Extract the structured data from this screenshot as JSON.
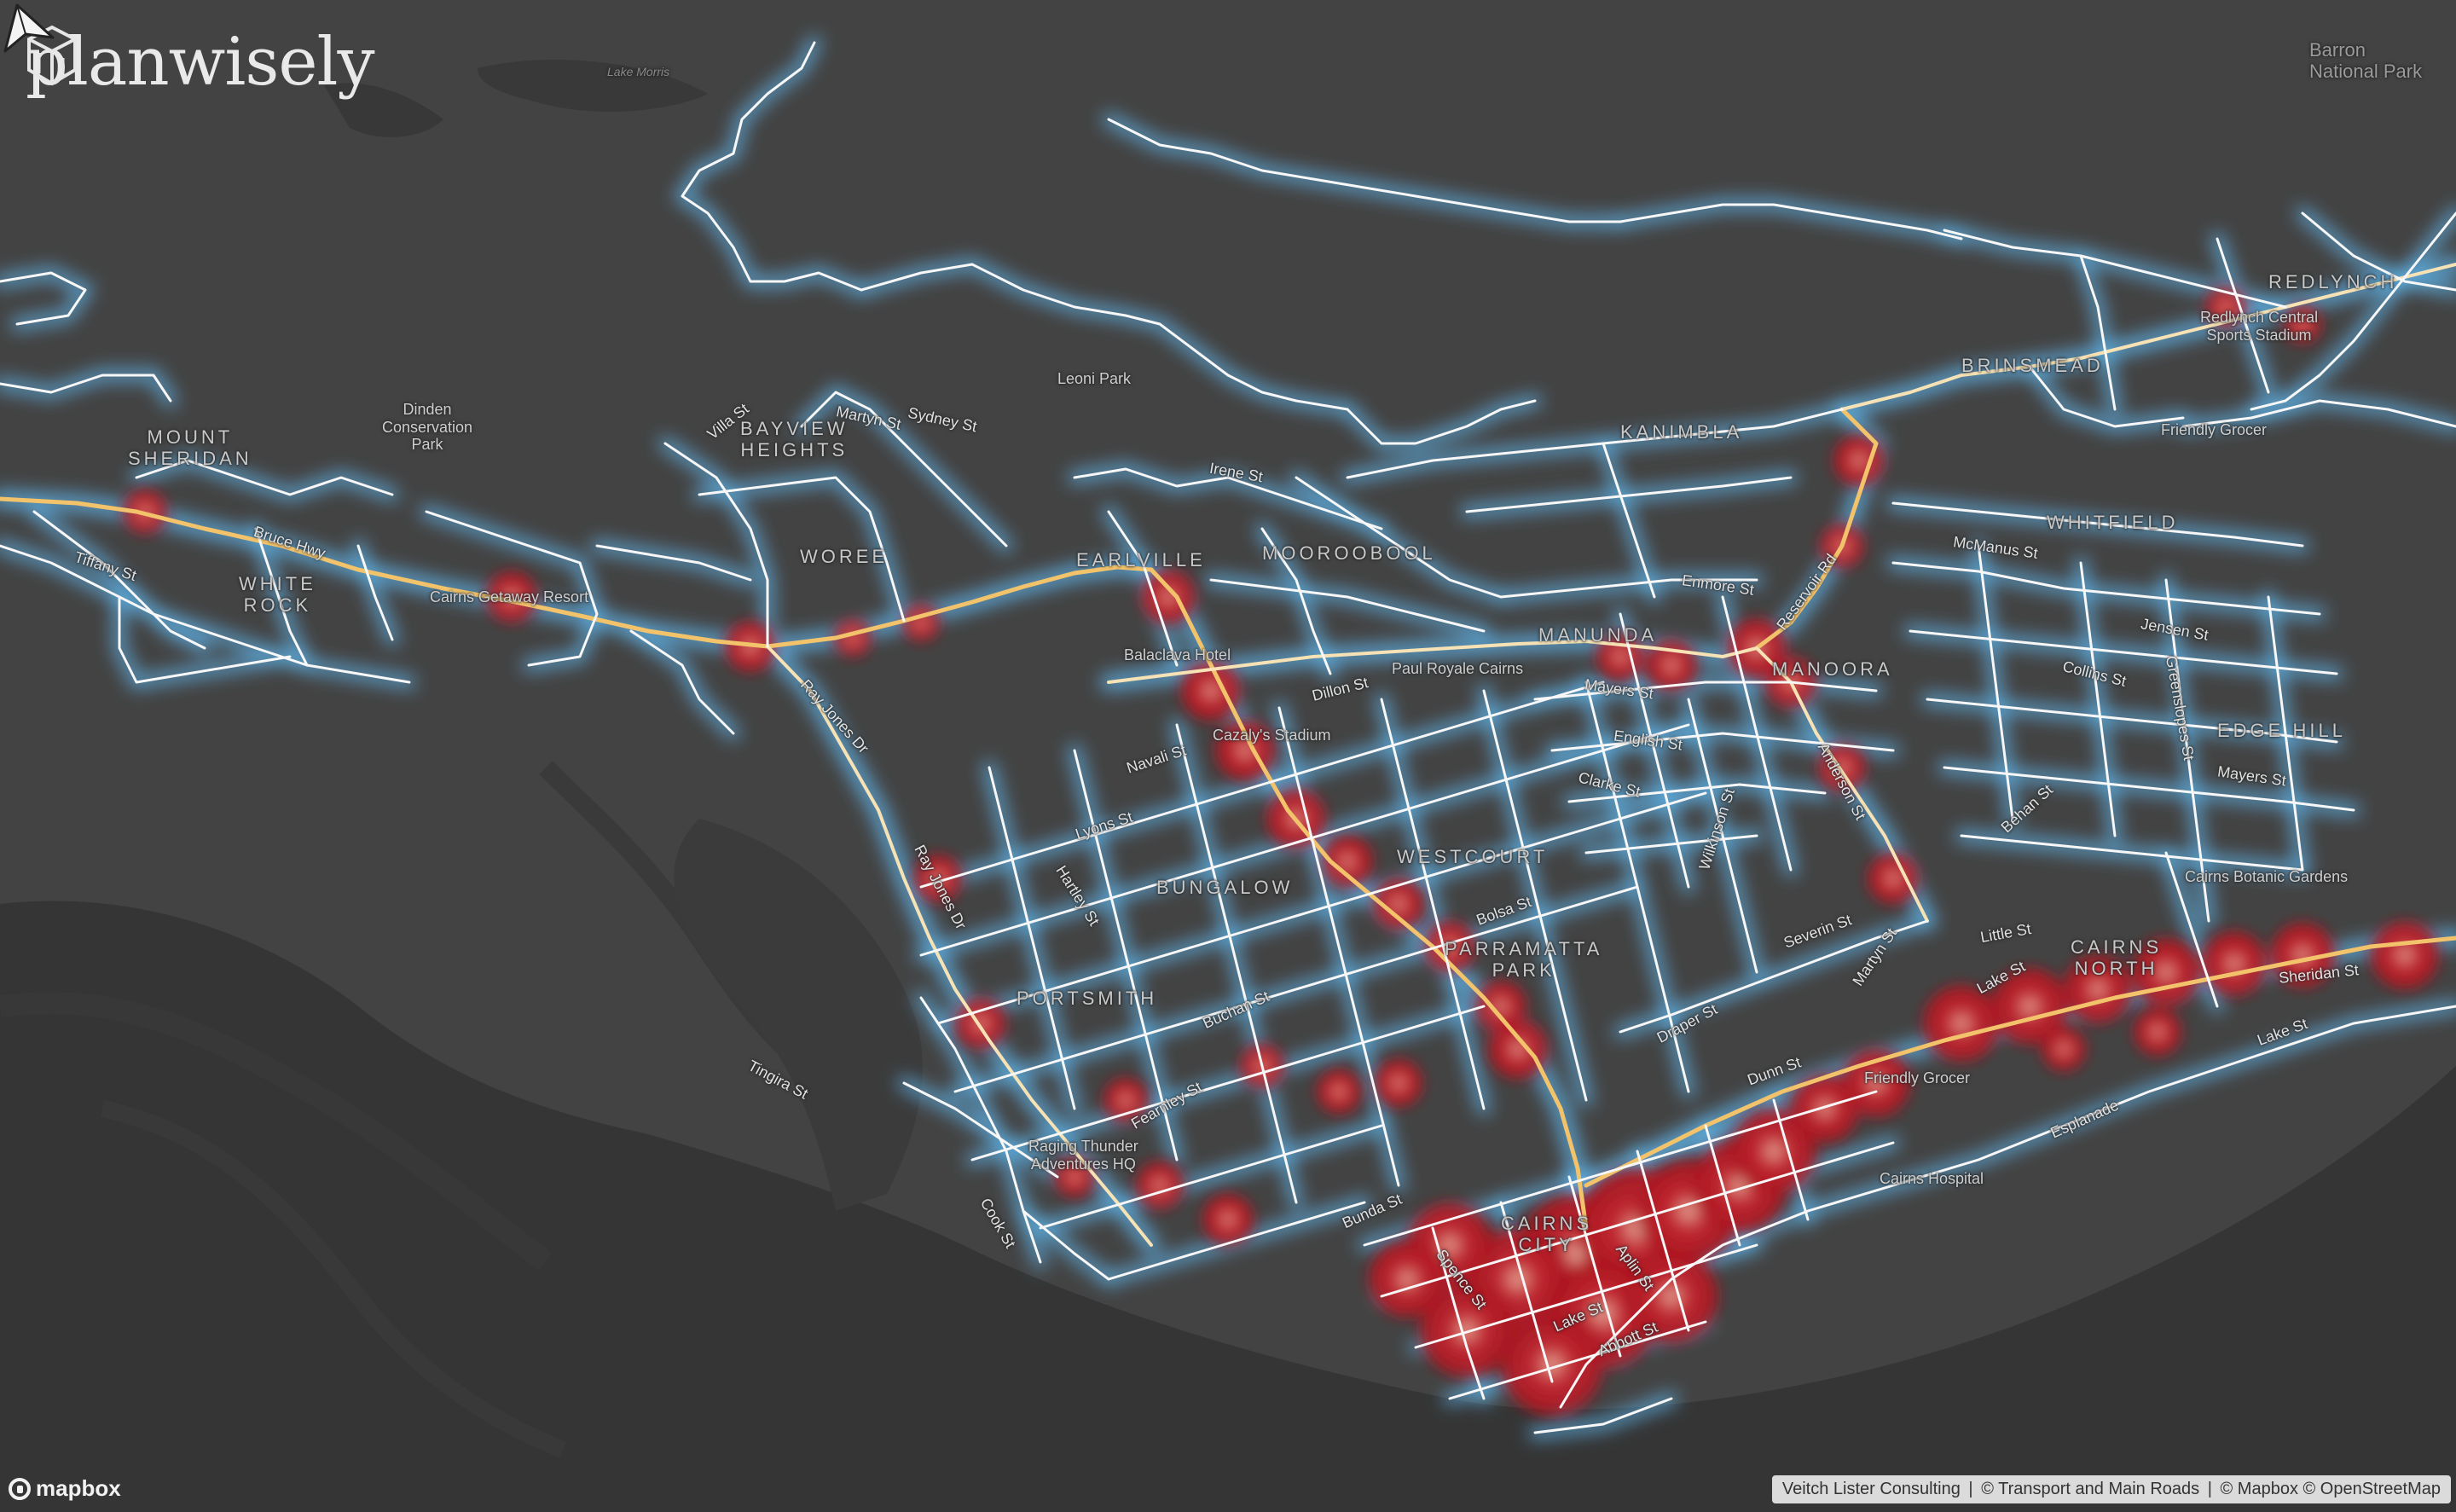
{
  "brand": {
    "name": "planwisely"
  },
  "mapbox_logo": "mapbox",
  "attribution": [
    "Veitch Lister Consulting",
    "© Transport and Main Roads",
    "© Mapbox © OpenStreetMap"
  ],
  "attribution_separator": "|",
  "colors": {
    "background": "#3d3d3d",
    "land": "#444444",
    "water": "#323232",
    "road": "#f7f7f7",
    "major_road": "#f2c36b",
    "glow": "#5fb4ea",
    "heat_high": "#b0141e",
    "heat_peak": "#e8b8a8"
  },
  "icons": {
    "brand": "planwisely-logo-icon",
    "navigation": "navigation-arrow-icon",
    "mapbox": "mapbox-logo-icon"
  },
  "labels": {
    "top_right": "Barron\nNational Park",
    "lake_morris": "Lake Morris",
    "suburbs": {
      "mount_sheridan": "MOUNT\nSHERIDAN",
      "white_rock": "WHITE\nROCK",
      "bayview_heights": "BAYVIEW\nHEIGHTS",
      "woree": "WOREE",
      "earlville": "EARLVILLE",
      "mooroobool": "MOOROOBOOL",
      "kanimbla": "KANIMBLA",
      "brinsmead": "BRINSMEAD",
      "redlynch": "REDLYNCH",
      "whitfield": "WHITFIELD",
      "manunda": "MANUNDA",
      "manoora": "MANOORA",
      "edge_hill": "EDGE HILL",
      "westcourt": "WESTCOURT",
      "bungalow": "BUNGALOW",
      "parramatta_park": "PARRAMATTA\nPARK",
      "portsmith": "PORTSMITH",
      "cairns_north": "CAIRNS\nNORTH",
      "cairns_city": "CAIRNS\nCITY"
    },
    "pois": {
      "dinden": "Dinden\nConservation\nPark",
      "leoni_park": "Leoni Park",
      "cairns_getaway": "Cairns Getaway Resort",
      "balaclava_hotel": "Balaclava Hotel",
      "barlow_park": "Cazaly's Stadium",
      "redlynch_sports": "Redlynch Central\nSports Stadium",
      "friendly_grocer_top": "Friendly Grocer",
      "cairns_botanic": "Cairns Botanic Gardens",
      "raging_thunder": "Raging Thunder\nAdventures HQ",
      "cairns_hospital": "Cairns Hospital",
      "friendly_grocer": "Friendly Grocer",
      "paul_royale": "Paul Royale Cairns"
    },
    "streets": {
      "tiffany": "Tiffany St",
      "bruce_hwy": "Bruce Hwy",
      "villa": "Villa St",
      "martyn": "Martyn St",
      "sydney": "Sydney St",
      "irene": "Irene St",
      "ray_jones": "Ray Jones Dr",
      "ray_jones_2": "Ray Jones Dr",
      "navali": "Navali St",
      "lyons": "Lyons St",
      "hartley": "Hartley St",
      "dillon": "Dillon St",
      "mayers": "Mayers St",
      "english": "English St",
      "clarke": "Clarke St",
      "enmore": "Enmore St",
      "mcmanus": "McManus St",
      "anderson": "Anderson St",
      "jensen": "Jensen St",
      "collins": "Collins St",
      "greenslopes": "Greenslopes St",
      "mayers_2": "Mayers St",
      "behan": "Behan St",
      "wilkinson": "Wilkinson St",
      "bolsa": "Bolsa St",
      "severin": "Severin St",
      "martyn_2": "Martyn St",
      "little": "Little St",
      "lake_st_north": "Lake St",
      "sheridan": "Sheridan St",
      "lake_st_east": "Lake St",
      "esplanade": "Esplanade",
      "draper": "Draper St",
      "dunn": "Dunn St",
      "buchan": "Buchan St",
      "fearnley": "Fearnley St",
      "tingira": "Tingira St",
      "cook": "Cook St",
      "bunda": "Bunda St",
      "spence": "Spence St",
      "aplin": "Aplin St",
      "lake_st": "Lake St",
      "abbott": "Abbott St",
      "redlynch_rd": "Reservoir Rd"
    }
  }
}
